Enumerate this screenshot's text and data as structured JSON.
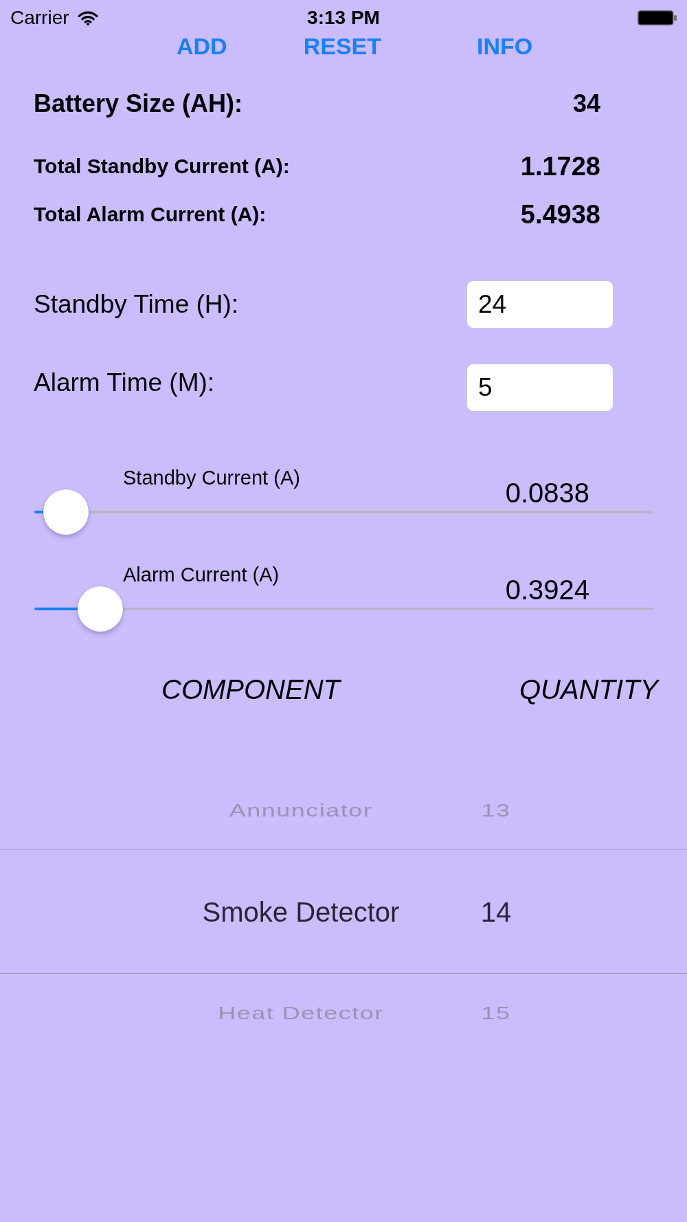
{
  "status_bar": {
    "carrier": "Carrier",
    "time": "3:13 PM"
  },
  "toolbar": [
    "ADD",
    "RESET",
    "INFO"
  ],
  "summary": [
    {
      "kind": "primary",
      "label": "Battery Size (AH):",
      "value": "34"
    },
    {
      "kind": "secondary",
      "label": "Total Standby Current (A):",
      "value": "1.1728"
    },
    {
      "kind": "secondary",
      "label": "Total Alarm Current (A):",
      "value": "5.4938"
    }
  ],
  "fields": [
    {
      "label": "Standby Time (H):",
      "value": "24"
    },
    {
      "label": "Alarm Time (M):",
      "value": "5"
    }
  ],
  "sliders": [
    {
      "label": "Standby Current (A)",
      "reading": "0.0838",
      "level": 0.015
    },
    {
      "label": "Alarm Current (A)",
      "reading": "0.3924",
      "level": 0.075
    }
  ],
  "picker": {
    "headers": [
      "COMPONENT",
      "QUANTITY"
    ],
    "wheels": [
      {
        "items": [
          {
            "label": "Annunciator",
            "selected": false
          },
          {
            "label": "Smoke Detector",
            "selected": true
          },
          {
            "label": "Heat Detector",
            "selected": false
          }
        ]
      },
      {
        "items": [
          {
            "label": "13",
            "selected": false
          },
          {
            "label": "14",
            "selected": true
          },
          {
            "label": "15",
            "selected": false
          }
        ]
      }
    ]
  }
}
